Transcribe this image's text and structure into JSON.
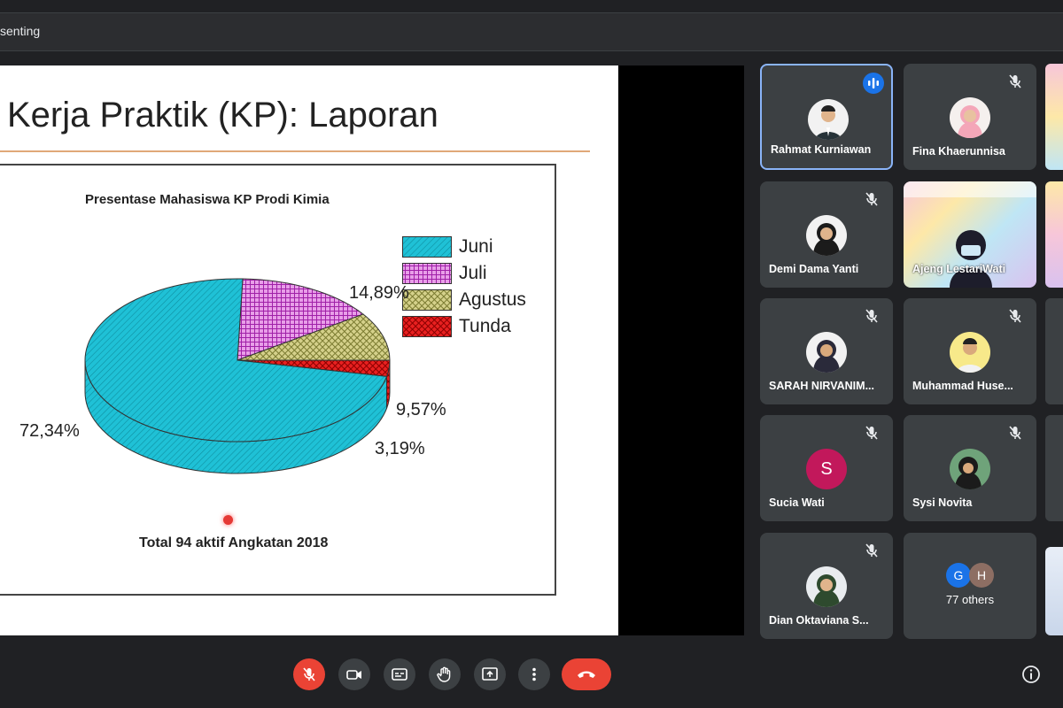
{
  "header": {
    "presenting_text": "senting"
  },
  "slide": {
    "title": "Kerja Praktik (KP): Laporan",
    "chart_title": "Presentase Mahasiswa KP Prodi Kimia",
    "note": "Total 94 aktif Angkatan 2018"
  },
  "chart_data": {
    "type": "pie",
    "title": "Presentase Mahasiswa KP Prodi Kimia",
    "categories": [
      "Juni",
      "Juli",
      "Agustus",
      "Tunda"
    ],
    "values": [
      72.34,
      14.89,
      9.57,
      3.19
    ],
    "labels": [
      "72,34%",
      "14,89%",
      "9,57%",
      "3,19%"
    ],
    "colors": [
      "#1fc1d6",
      "#c050c8",
      "#b8b860",
      "#e02020"
    ],
    "legend": "top-right",
    "note": "Total 94 aktif Angkatan 2018"
  },
  "participants": [
    {
      "name": "Rahmat Kurniawan",
      "speaking": true,
      "muted": false
    },
    {
      "name": "Fina Khaerunnisa",
      "muted": true
    },
    {
      "name": "Demi Dama Yanti",
      "muted": true
    },
    {
      "name": "Ajeng LestariWati",
      "muted": false
    },
    {
      "name": "SARAH NIRVANIM...",
      "muted": true
    },
    {
      "name": "Muhammad Huse...",
      "muted": true
    },
    {
      "name": "Sucia Wati",
      "initial": "S",
      "muted": true
    },
    {
      "name": "Sysi Novita",
      "muted": true
    },
    {
      "name": "Dian Oktaviana S...",
      "muted": true
    }
  ],
  "others": {
    "label": "77 others",
    "initials": [
      "G",
      "H"
    ],
    "colors": [
      "#1a73e8",
      "#8d6e63"
    ]
  },
  "controls": [
    "mic-off-icon",
    "camera-icon",
    "captions-icon",
    "raise-hand-icon",
    "present-icon",
    "more-icon",
    "leave-call-icon",
    "info-icon"
  ],
  "colors": {
    "accent": "#8ab4f8",
    "danger": "#ea4335",
    "tile": "#3c4043"
  }
}
